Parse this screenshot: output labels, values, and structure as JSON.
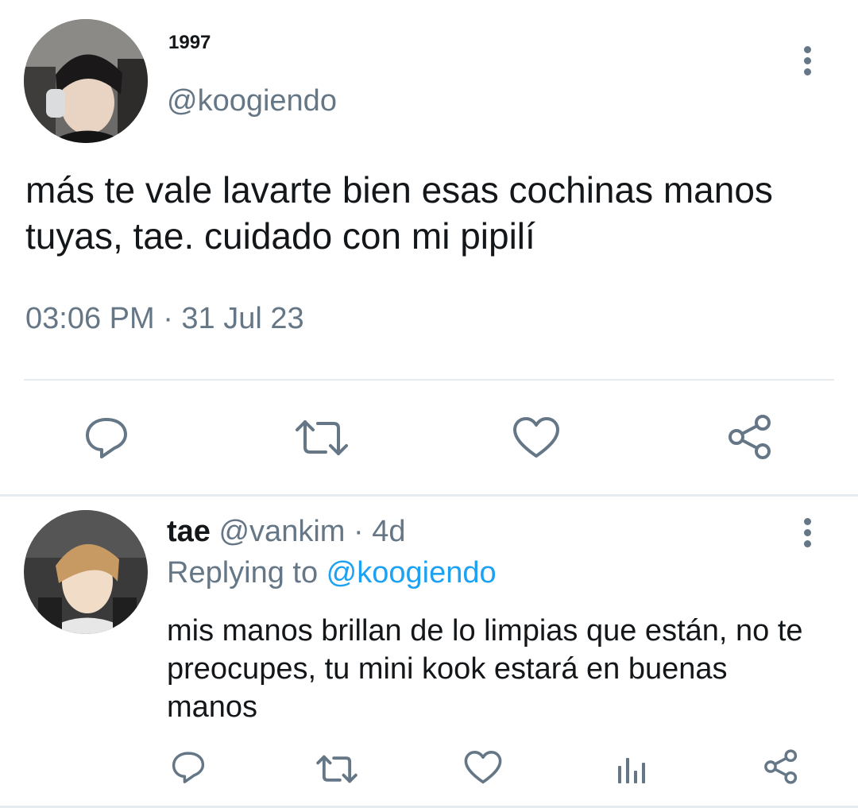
{
  "main_tweet": {
    "author": {
      "display_name": "1997",
      "handle": "@koogiendo"
    },
    "text": "más te vale lavarte bien esas cochinas manos tuyas, tae. cuidado con mi pipilí",
    "timestamp": "03:06 PM · 31 Jul 23",
    "actions": [
      "reply-icon",
      "retweet-icon",
      "like-icon",
      "share-icon"
    ]
  },
  "reply": {
    "author": {
      "display_name": "tae",
      "handle": "@vankim",
      "age": "· 4d"
    },
    "replying_prefix": "Replying to ",
    "replying_to": "@koogiendo",
    "text": "mis manos brillan de lo limpias que están, no te preocupes, tu mini kook estará en buenas manos",
    "actions": [
      "reply-icon",
      "retweet-icon",
      "like-icon",
      "analytics-icon",
      "share-icon"
    ]
  },
  "colors": {
    "text_primary": "#14171a",
    "text_secondary": "#657786",
    "link": "#1da1f2",
    "divider": "#e6ecf0"
  }
}
